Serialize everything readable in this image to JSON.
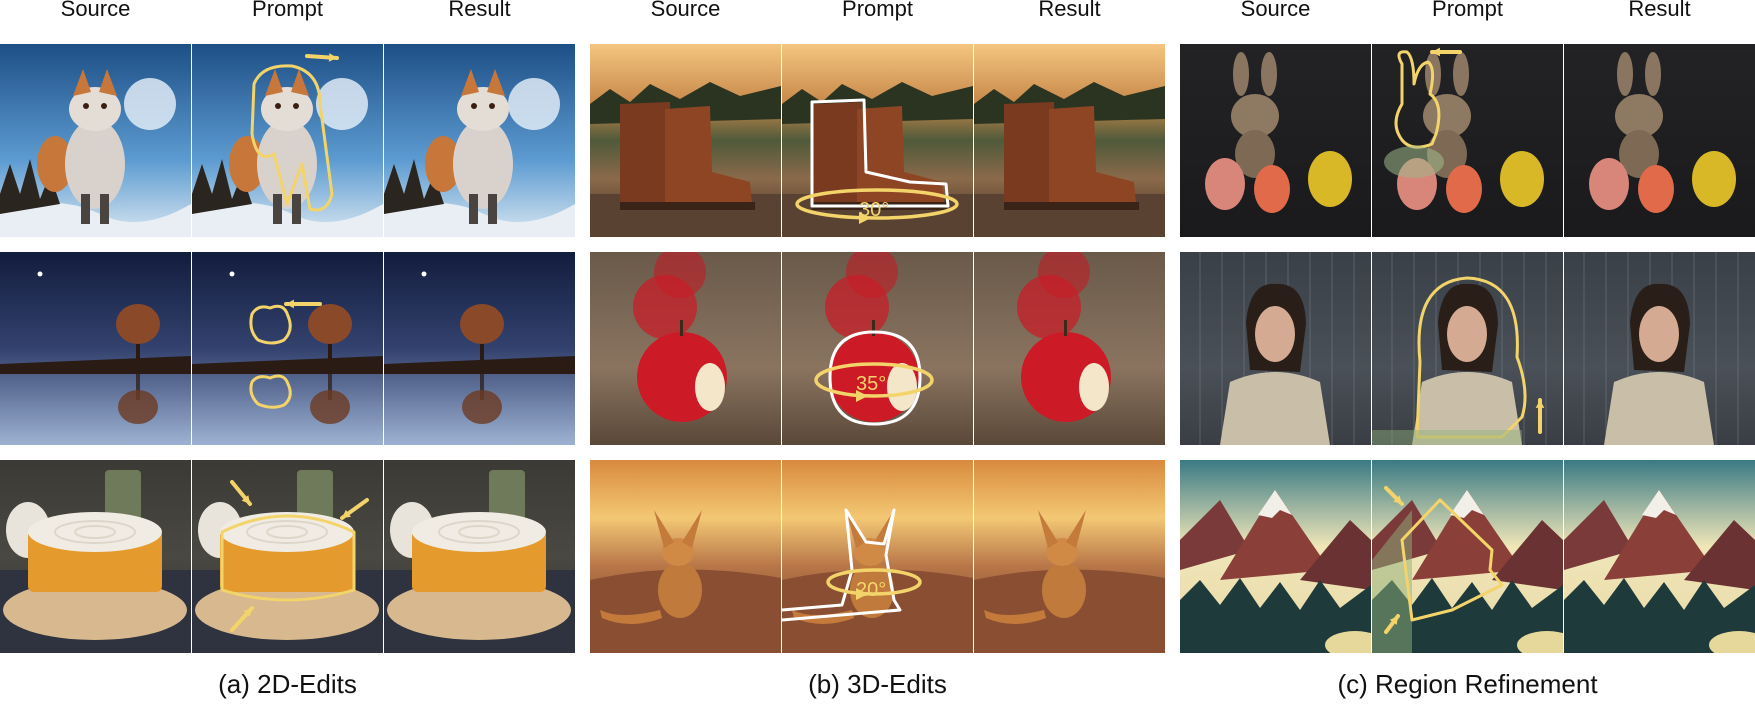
{
  "colors": {
    "annotation": "#f3d46a",
    "outline_white": "#ffffff"
  },
  "groups": [
    {
      "caption": "(a) 2D-Edits",
      "columns": [
        "Source",
        "Prompt",
        "Result"
      ],
      "rows": [
        {
          "subject": "fox-in-snow"
        },
        {
          "subject": "tree-reflection"
        },
        {
          "subject": "cake"
        }
      ]
    },
    {
      "caption": "(b) 3D-Edits",
      "columns": [
        "Source",
        "Prompt",
        "Result"
      ],
      "rows": [
        {
          "subject": "boots-on-dock",
          "angle": "30°"
        },
        {
          "subject": "apple",
          "angle": "35°"
        },
        {
          "subject": "fennec-fox",
          "angle": "20°"
        }
      ]
    },
    {
      "caption": "(c) Region Refinement",
      "columns": [
        "Source",
        "Prompt",
        "Result"
      ],
      "rows": [
        {
          "subject": "knitted-bunny"
        },
        {
          "subject": "woman-in-rain"
        },
        {
          "subject": "mountains"
        }
      ]
    }
  ]
}
